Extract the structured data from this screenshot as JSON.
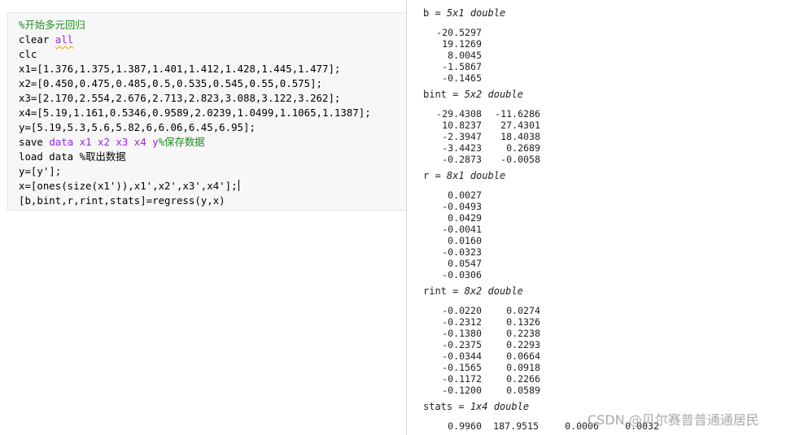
{
  "editor": {
    "lines": [
      "%开始多元回归",
      "clear all",
      "clc",
      "x1=[1.376,1.375,1.387,1.401,1.412,1.428,1.445,1.477];",
      "x2=[0.450,0.475,0.485,0.5,0.535,0.545,0.55,0.575];",
      "x3=[2.170,2.554,2.676,2.713,2.823,3.088,3.122,3.262];",
      "x4=[5.19,1.161,0.5346,0.9589,2.0239,1.0499,1.1065,1.1387];",
      "y=[5.19,5.3,5.6,5.82,6,6.06,6.45,6.95];",
      "save data x1 x2 x3 x4 y%保存数据",
      "load data %取出数据",
      "y=[y'];",
      "x=[ones(size(x1')),x1',x2',x3',x4'];",
      "[b,bint,r,rint,stats]=regress(y,x)"
    ],
    "tokens": {
      "line1_comment": "%开始多元回归",
      "line2_kw": "clear ",
      "line2_arg": "all",
      "line9_kw": "save ",
      "line9_args": "data x1 x2 x3 x4 y",
      "line9_comment": "%保存数据",
      "line10_code": "load data ",
      "line10_comment": "%取出数据"
    }
  },
  "output": {
    "b": {
      "name": "b",
      "eq": " = ",
      "dims": "5x1 double",
      "rows": [
        [
          "-20.5297"
        ],
        [
          "19.1269"
        ],
        [
          "8.0045"
        ],
        [
          "-1.5867"
        ],
        [
          "-0.1465"
        ]
      ]
    },
    "bint": {
      "name": "bint",
      "eq": " = ",
      "dims": "5x2 double",
      "rows": [
        [
          "-29.4308",
          "-11.6286"
        ],
        [
          "10.8237",
          "27.4301"
        ],
        [
          "-2.3947",
          "18.4038"
        ],
        [
          "-3.4423",
          "0.2689"
        ],
        [
          "-0.2873",
          "-0.0058"
        ]
      ]
    },
    "r": {
      "name": "r",
      "eq": " = ",
      "dims": "8x1 double",
      "rows": [
        [
          "0.0027"
        ],
        [
          "-0.0493"
        ],
        [
          "0.0429"
        ],
        [
          "-0.0041"
        ],
        [
          "0.0160"
        ],
        [
          "-0.0323"
        ],
        [
          "0.0547"
        ],
        [
          "-0.0306"
        ]
      ]
    },
    "rint": {
      "name": "rint",
      "eq": " = ",
      "dims": "8x2 double",
      "rows": [
        [
          "-0.0220",
          "0.0274"
        ],
        [
          "-0.2312",
          "0.1326"
        ],
        [
          "-0.1380",
          "0.2238"
        ],
        [
          "-0.2375",
          "0.2293"
        ],
        [
          "-0.0344",
          "0.0664"
        ],
        [
          "-0.1565",
          "0.0918"
        ],
        [
          "-0.1172",
          "0.2266"
        ],
        [
          "-0.1200",
          "0.0589"
        ]
      ]
    },
    "stats": {
      "name": "stats",
      "eq": " = ",
      "dims": "1x4 double",
      "rows": [
        [
          "0.9960",
          "187.9515",
          "0.0006",
          "0.0032"
        ]
      ]
    }
  },
  "watermark": "CSDN @贝尔赛普普通通居民"
}
